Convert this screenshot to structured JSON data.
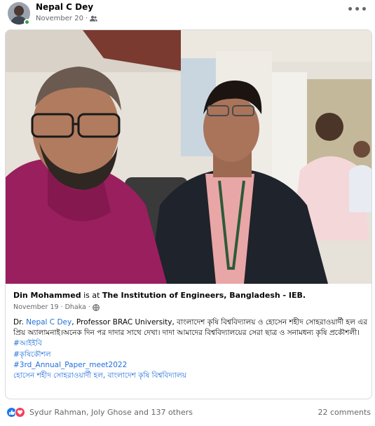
{
  "post": {
    "author": "Nepal C Dey",
    "date": "November 20",
    "audience_icon": "friends-icon",
    "more_icon": "more-options-icon"
  },
  "shared": {
    "author": "Din Mohammed",
    "is_at": "is at",
    "place": "The Institution of Engineers, Bangladesh - IEB.",
    "date": "November 19",
    "location": "Dhaka",
    "separator": "·",
    "body_prefix": "Dr.",
    "body_link": "Nepal C Dey",
    "body_text": ", Professor BRAC University, বাংলাদেশ কৃষি বিশ্ববিদ্যালয় ও হোসেন শহীদ সোহরাওয়ার্দী হল এর প্রিয় অ্যালামনাই।অনেক দিন পর দাদার সাথে দেখা। দাদা আমাদের বিশ্ববিদ্যালয়ের সেরা ছাত্র ও সনামধন্য কৃষি প্রকৌশলী।",
    "hashtags": [
      "#আইইবি",
      "#কৃষিকৌশল",
      "#3rd_Annual_Paper_meet2022"
    ],
    "location_tag": "হোসেন শহীদ সোহরাওয়ার্দী হল, বাংলাদেশ কৃষি বিশ্ববিদ্যালয়"
  },
  "reactions": {
    "summary": "Sydur Rahman, Joly Ghose and 137 others",
    "types": [
      "like-icon",
      "love-icon"
    ],
    "comments": "22 comments"
  },
  "colors": {
    "link": "#216fdb",
    "secondary_text": "#65676b",
    "like": "#1877f2",
    "love": "#f33e58",
    "online": "#31a24c"
  }
}
